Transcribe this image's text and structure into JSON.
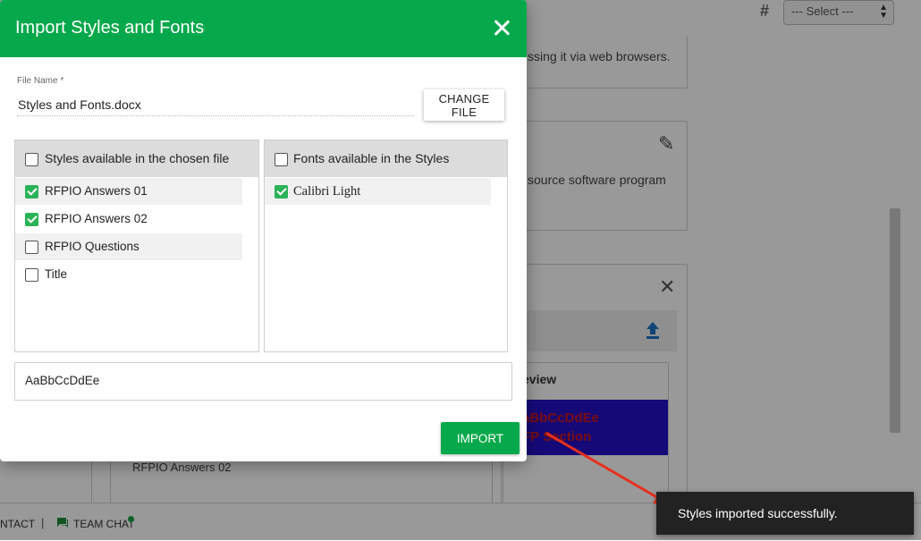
{
  "background": {
    "select_value": "--- Select ---",
    "card1_text": "ssing it via web browsers.",
    "card2_text": "source software program",
    "preview_header": "eview",
    "preview_line1": "aBbCcDdEe",
    "preview_line2": "FP Section",
    "bottom_item": "RFPIO Answers 02",
    "footer_contact": "NTACT",
    "footer_separator": "|",
    "footer_team_chat": "TEAM CHAT"
  },
  "modal": {
    "title": "Import Styles and Fonts",
    "file_label": "File Name *",
    "file_value": "Styles and Fonts.docx",
    "change_file_label": "CHANGE FILE",
    "styles_panel": {
      "header": "Styles available in the chosen file",
      "all_checked": false,
      "items": [
        {
          "label": "RFPIO Answers 01",
          "checked": true
        },
        {
          "label": "RFPIO Answers 02",
          "checked": true
        },
        {
          "label": "RFPIO Questions",
          "checked": false
        },
        {
          "label": "Title",
          "checked": false
        }
      ]
    },
    "fonts_panel": {
      "header": "Fonts available in the Styles",
      "all_checked": false,
      "items": [
        {
          "label": "Calibri Light",
          "checked": true
        }
      ]
    },
    "preview_text": "AaBbCcDdEe",
    "import_label": "IMPORT"
  },
  "toast": {
    "message": "Styles imported successfully."
  },
  "colors": {
    "accent": "#05a84a",
    "checkbox_checked": "#2bb358",
    "toast_bg": "#222222",
    "annotation_arrow": "#e8301c"
  }
}
